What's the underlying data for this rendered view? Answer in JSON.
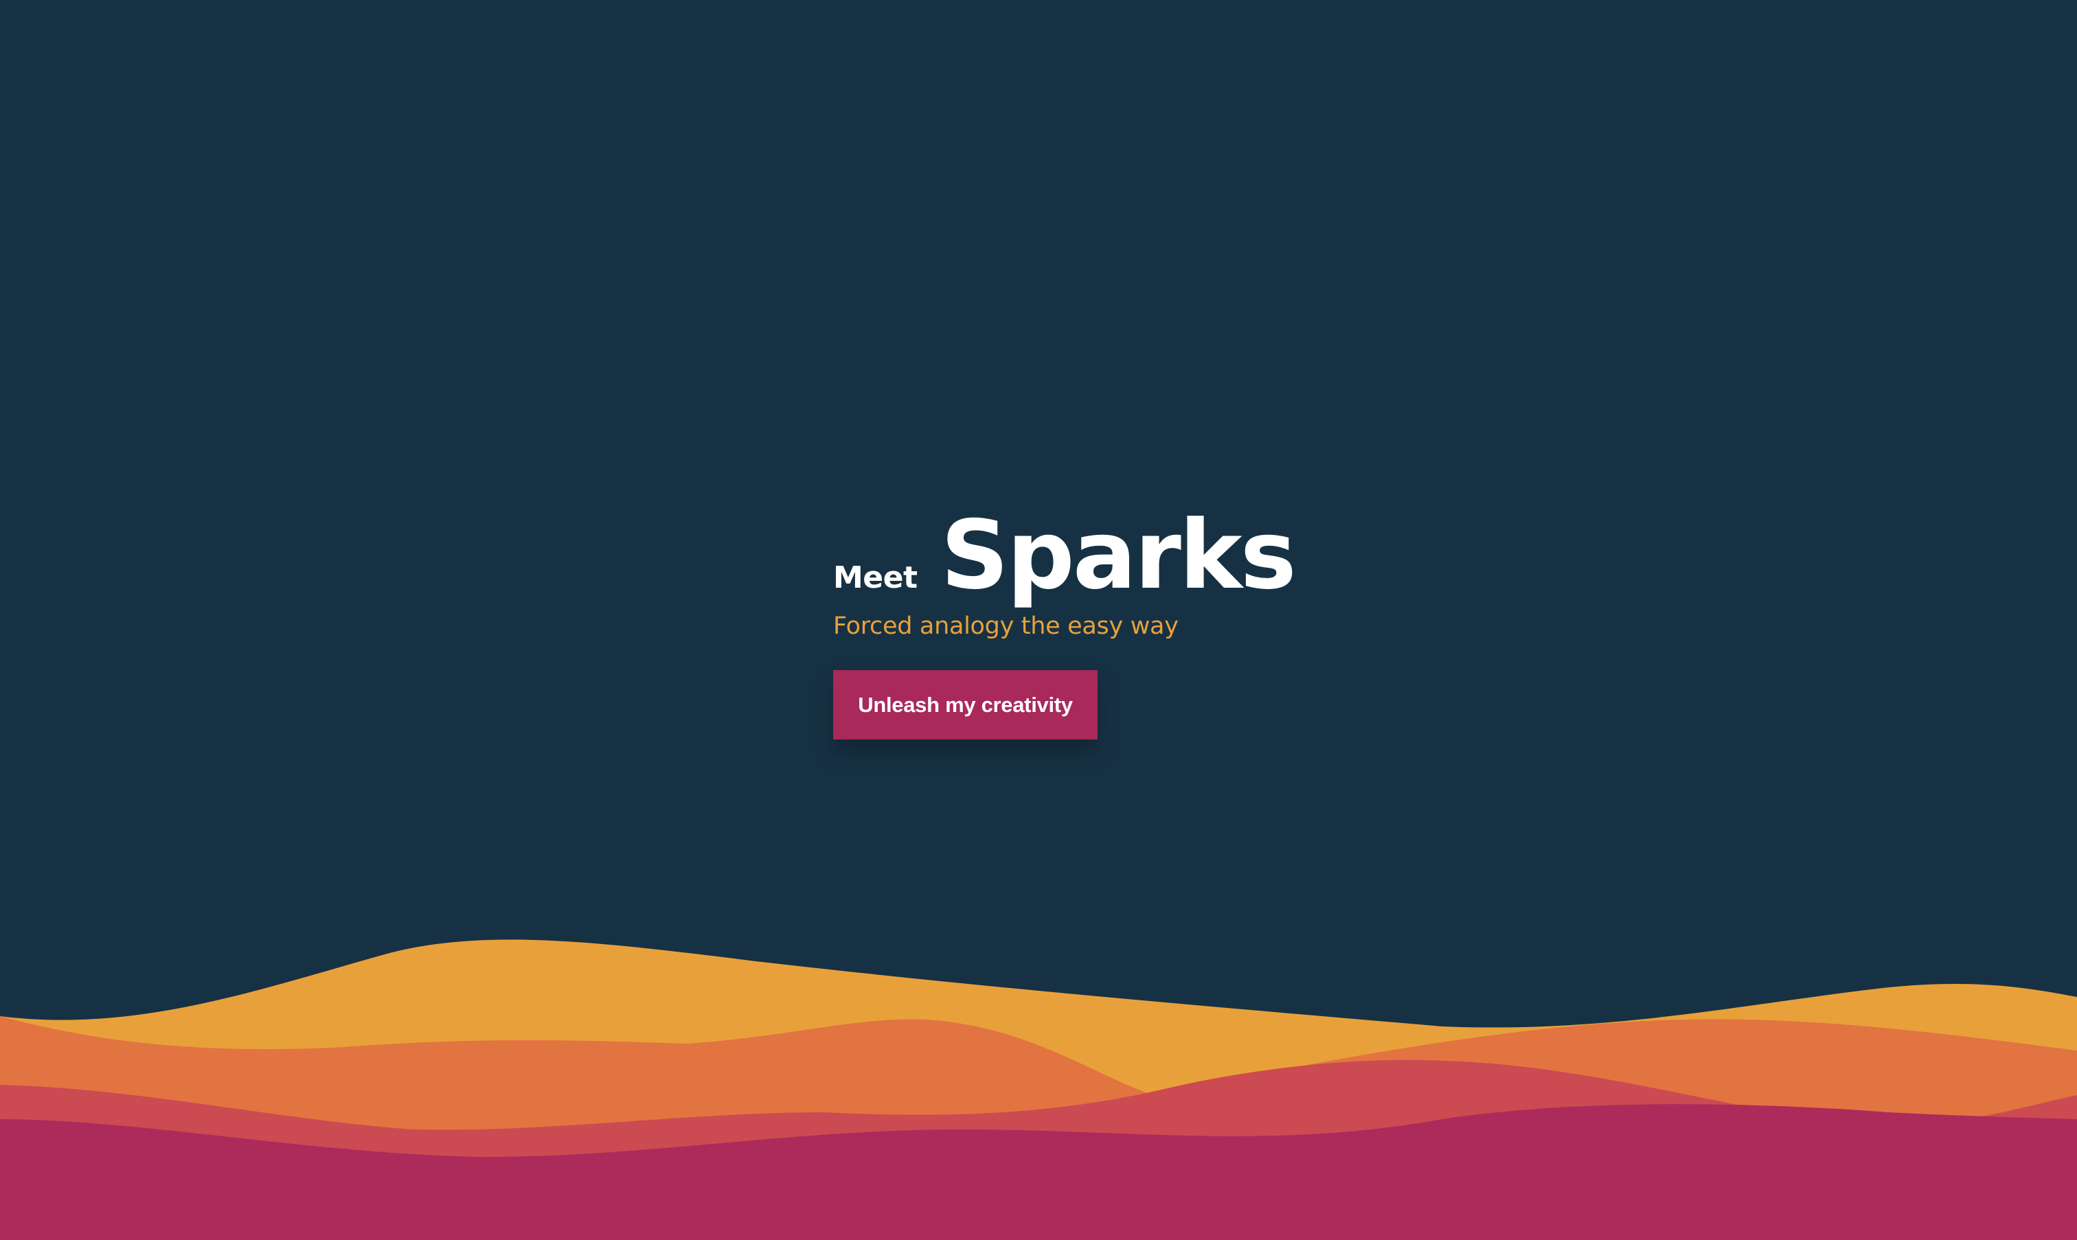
{
  "hero": {
    "meet_label": "Meet",
    "brand_name": "Sparks",
    "tagline": "Forced analogy the easy way",
    "cta_label": "Unleash my creativity"
  },
  "colors": {
    "background": "#173144",
    "accent_text": "#e8a13a",
    "button": "#a8295a",
    "wave_layers": [
      "#e8a13a",
      "#e27441",
      "#cc4a51",
      "#ad2b5b"
    ]
  }
}
